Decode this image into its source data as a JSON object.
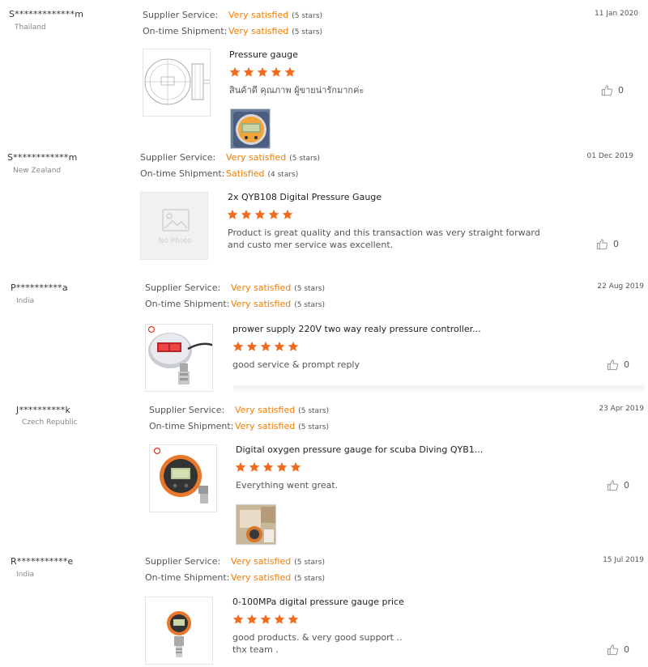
{
  "labels": {
    "supplier_service": "Supplier Service:",
    "ontime_shipment": "On-time Shipment:"
  },
  "reviews": [
    {
      "buyer": "S*************m",
      "country": "Thailand",
      "date": "11 Jan 2020",
      "supplier_rating": "Very satisfied",
      "supplier_stars": "(5 stars)",
      "shipment_rating": "Very satisfied",
      "shipment_stars": "(5 stars)",
      "product": "Pressure gauge",
      "comment": "สินค้าดี คุณภาพ ผู้ขายน่ารักมากค่ะ",
      "likes": "0"
    },
    {
      "buyer": "S************m",
      "country": "New Zealand",
      "date": "01 Dec 2019",
      "supplier_rating": "Very satisfied",
      "supplier_stars": "(5 stars)",
      "shipment_rating": "Satisfied",
      "shipment_stars": "(4 stars)",
      "product": "2x QYB108 Digital Pressure Gauge",
      "comment": "Product is great quality and this transaction was very straight forward and custo mer service was excellent.",
      "no_photo": "No Photo",
      "likes": "0"
    },
    {
      "buyer": "P**********a",
      "country": "India",
      "date": "22 Aug 2019",
      "supplier_rating": "Very satisfied",
      "supplier_stars": "(5 stars)",
      "shipment_rating": "Very satisfied",
      "shipment_stars": "(5 stars)",
      "product": "prower supply 220V two way realy pressure controller...",
      "comment": "good service & prompt reply",
      "likes": "0"
    },
    {
      "buyer": "J**********k",
      "country": "Czech Republic",
      "date": "23 Apr 2019",
      "supplier_rating": "Very satisfied",
      "supplier_stars": "(5 stars)",
      "shipment_rating": "Very satisfied",
      "shipment_stars": "(5 stars)",
      "product": "Digital oxygen pressure gauge for scuba Diving QYB1...",
      "comment": "Everything went great.",
      "likes": "0"
    },
    {
      "buyer": "R***********e",
      "country": "India",
      "date": "15 Jul 2019",
      "supplier_rating": "Very satisfied",
      "supplier_stars": "(5 stars)",
      "shipment_rating": "Very satisfied",
      "shipment_stars": "(5 stars)",
      "product": "0-100MPa digital pressure gauge price",
      "comment_line1": "good products. &  very good support ..",
      "comment_line2": "thx team .",
      "likes": "0"
    }
  ],
  "colors": {
    "accent": "#f57c00",
    "star": "#f26b1d"
  },
  "product_rating": 5
}
